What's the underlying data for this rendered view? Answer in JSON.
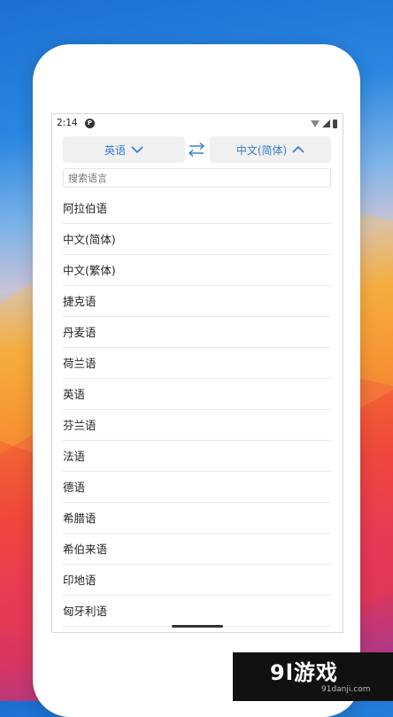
{
  "status_bar": {
    "time": "2:14",
    "app_icon_letter": "P"
  },
  "source_language": {
    "label": "英语",
    "icon": "chevron-down-icon"
  },
  "swap": {
    "icon": "swap-arrows-icon"
  },
  "target_language": {
    "label": "中文(简体)",
    "icon": "chevron-up-icon"
  },
  "search": {
    "placeholder": "搜索语言",
    "value": ""
  },
  "languages": [
    {
      "label": "阿拉伯语"
    },
    {
      "label": "中文(简体)"
    },
    {
      "label": "中文(繁体)"
    },
    {
      "label": "捷克语"
    },
    {
      "label": "丹麦语"
    },
    {
      "label": "荷兰语"
    },
    {
      "label": "英语"
    },
    {
      "label": "芬兰语"
    },
    {
      "label": "法语"
    },
    {
      "label": "德语"
    },
    {
      "label": "希腊语"
    },
    {
      "label": "希伯来语"
    },
    {
      "label": "印地语"
    },
    {
      "label": "匈牙利语"
    }
  ],
  "watermark": {
    "logo": "9l游戏",
    "url": "91danji.com"
  },
  "colors": {
    "accent": "#2f7ccd",
    "button_bg": "#f0f0f0"
  }
}
